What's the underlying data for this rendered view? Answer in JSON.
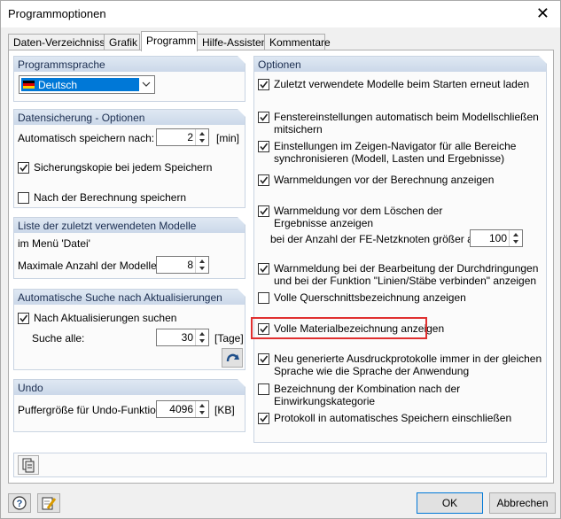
{
  "window": {
    "title": "Programmoptionen",
    "close_glyph": "✕"
  },
  "tabs": [
    "Daten-Verzeichnisse",
    "Grafik",
    "Programm",
    "Hilfe-Assistent",
    "Kommentare"
  ],
  "language": {
    "header": "Programmsprache",
    "selected": "Deutsch"
  },
  "backup": {
    "header": "Datensicherung - Optionen",
    "autosave_label": "Automatisch speichern nach:",
    "autosave_value": "2",
    "autosave_unit": "[min]",
    "backup_copy": "Sicherungskopie bei jedem Speichern",
    "save_after_calc": "Nach der Berechnung speichern"
  },
  "recent": {
    "header": "Liste der zuletzt verwendeten Modelle",
    "menu_label": "im Menü 'Datei'",
    "max_label": "Maximale Anzahl der Modelle:",
    "max_value": "8"
  },
  "updates": {
    "header": "Automatische Suche nach Aktualisierungen",
    "check_label": "Nach Aktualisierungen suchen",
    "interval_label": "Suche alle:",
    "interval_value": "30",
    "interval_unit": "[Tage]"
  },
  "undo": {
    "header": "Undo",
    "buffer_label": "Puffergröße für Undo-Funktion:",
    "buffer_value": "4096",
    "buffer_unit": "[KB]"
  },
  "options": {
    "header": "Optionen",
    "o1": "Zuletzt verwendete Modelle beim Starten erneut laden",
    "o2a": "Fenstereinstellungen automatisch beim Modellschließen",
    "o2b": "mitsichern",
    "o3a": "Einstellungen im Zeigen-Navigator für alle Bereiche",
    "o3b": "synchronisieren (Modell, Lasten und Ergebnisse)",
    "o4": "Warnmeldungen vor der Berechnung anzeigen",
    "o5a": "Warnmeldung vor dem Löschen der",
    "o5b": "Ergebnisse anzeigen",
    "o5_nodes_label": "bei der Anzahl der FE-Netzknoten größer als:",
    "o5_nodes_value": "100",
    "o6a": "Warnmeldung bei der Bearbeitung der Durchdringungen",
    "o6b": "und bei der Funktion \"Linien/Stäbe verbinden\" anzeigen",
    "o7": "Volle Querschnittsbezeichnung anzeigen",
    "o8": "Volle Materialbezeichnung anzeigen",
    "o9a": "Neu generierte Ausdruckprotokolle immer in der gleichen",
    "o9b": "Sprache wie die Sprache der Anwendung",
    "o10a": "Bezeichnung der Kombination nach der",
    "o10b": "Einwirkungskategorie",
    "o11": "Protokoll in automatisches Speichern einschließen"
  },
  "buttons": {
    "ok": "OK",
    "cancel": "Abbrechen"
  }
}
